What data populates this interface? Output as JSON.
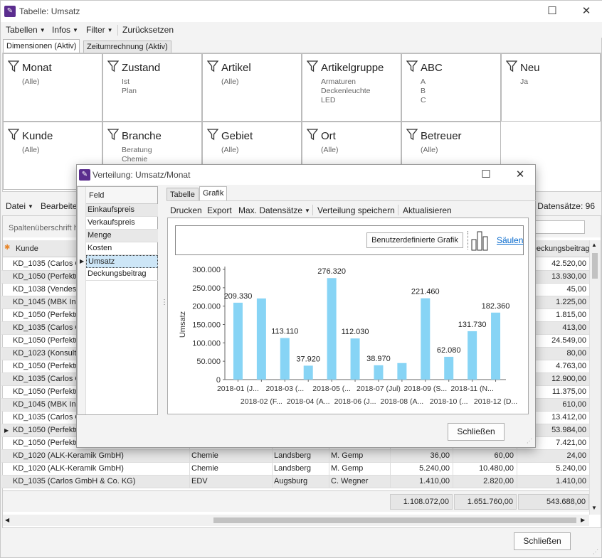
{
  "window": {
    "title": "Tabelle: Umsatz"
  },
  "menu": {
    "tabellen": "Tabellen",
    "infos": "Infos",
    "filter": "Filter",
    "reset": "Zurücksetzen"
  },
  "tabs": {
    "dims": "Dimensionen (Aktiv)",
    "time": "Zeitumrechnung (Aktiv)"
  },
  "dimensions": [
    {
      "name": "Monat",
      "values": [
        "(Alle)"
      ]
    },
    {
      "name": "Zustand",
      "values": [
        "Ist",
        "Plan"
      ]
    },
    {
      "name": "Artikel",
      "values": [
        "(Alle)"
      ]
    },
    {
      "name": "Artikelgruppe",
      "values": [
        "Armaturen",
        "Deckenleuchte",
        "LED"
      ]
    },
    {
      "name": "ABC",
      "values": [
        "A",
        "B",
        "C"
      ]
    },
    {
      "name": "Neu",
      "values": [
        "Ja"
      ]
    },
    {
      "name": "Kunde",
      "values": [
        "(Alle)"
      ]
    },
    {
      "name": "Branche",
      "values": [
        "Beratung",
        "Chemie"
      ]
    },
    {
      "name": "Gebiet",
      "values": [
        "(Alle)"
      ]
    },
    {
      "name": "Ort",
      "values": [
        "(Alle)"
      ]
    },
    {
      "name": "Betreuer",
      "values": [
        "(Alle)"
      ]
    }
  ],
  "toolbar": {
    "datei": "Datei",
    "bearbeiten": "Bearbeiten",
    "datensaetze": "Datensätze: 96"
  },
  "grid": {
    "hint": "Spaltenüberschrift hierher ziehen, um nach dieser Spalte zu gruppieren",
    "col_kunde": "Kunde",
    "col_deckungsbeitrag": "Deckungsbeitrag",
    "rows": [
      {
        "kunde": "KD_1035 (Carlos GmbH & Co. KG)",
        "branche": "",
        "gebiet": "",
        "betreuer": "",
        "ek": "",
        "vk": "",
        "db": "42.520,00"
      },
      {
        "kunde": "KD_1050 (Perfektum AG)",
        "branche": "",
        "gebiet": "",
        "betreuer": "",
        "ek": "",
        "vk": "",
        "db": "13.930,00"
      },
      {
        "kunde": "KD_1038 (Vendes GmbH)",
        "branche": "",
        "gebiet": "",
        "betreuer": "",
        "ek": "",
        "vk": "",
        "db": "45,00"
      },
      {
        "kunde": "KD_1045 (MBK Innenausbau)",
        "branche": "",
        "gebiet": "",
        "betreuer": "",
        "ek": "",
        "vk": "",
        "db": "1.225,00"
      },
      {
        "kunde": "KD_1050 (Perfektum AG)",
        "branche": "",
        "gebiet": "",
        "betreuer": "",
        "ek": "",
        "vk": "",
        "db": "1.815,00"
      },
      {
        "kunde": "KD_1035 (Carlos GmbH & Co. KG)",
        "branche": "",
        "gebiet": "",
        "betreuer": "",
        "ek": "",
        "vk": "",
        "db": "413,00"
      },
      {
        "kunde": "KD_1050 (Perfektum AG)",
        "branche": "",
        "gebiet": "",
        "betreuer": "",
        "ek": "",
        "vk": "",
        "db": "24.549,00"
      },
      {
        "kunde": "KD_1023 (Konsult GmbH)",
        "branche": "",
        "gebiet": "",
        "betreuer": "",
        "ek": "",
        "vk": "",
        "db": "80,00"
      },
      {
        "kunde": "KD_1050 (Perfektum AG)",
        "branche": "",
        "gebiet": "",
        "betreuer": "",
        "ek": "",
        "vk": "",
        "db": "4.763,00"
      },
      {
        "kunde": "KD_1035 (Carlos GmbH & Co. KG)",
        "branche": "",
        "gebiet": "",
        "betreuer": "",
        "ek": "",
        "vk": "",
        "db": "12.900,00"
      },
      {
        "kunde": "KD_1050 (Perfektum AG)",
        "branche": "",
        "gebiet": "",
        "betreuer": "",
        "ek": "",
        "vk": "",
        "db": "11.375,00"
      },
      {
        "kunde": "KD_1045 (MBK Innenausbau)",
        "branche": "",
        "gebiet": "",
        "betreuer": "",
        "ek": "",
        "vk": "",
        "db": "610,00"
      },
      {
        "kunde": "KD_1035 (Carlos GmbH & Co. KG)",
        "branche": "",
        "gebiet": "",
        "betreuer": "",
        "ek": "",
        "vk": "",
        "db": "13.412,00"
      },
      {
        "kunde": "KD_1050 (Perfektum AG)",
        "branche": "",
        "gebiet": "",
        "betreuer": "",
        "ek": "",
        "vk": "",
        "db": "53.984,00"
      },
      {
        "kunde": "KD_1050 (Perfektum AG)",
        "branche": "",
        "gebiet": "",
        "betreuer": "",
        "ek": "",
        "vk": "",
        "db": "7.421,00"
      },
      {
        "kunde": "KD_1020 (ALK-Keramik GmbH)",
        "branche": "Chemie",
        "gebiet": "Landsberg",
        "betreuer": "M. Gemp",
        "ek": "36,00",
        "vk": "60,00",
        "db": "24,00"
      },
      {
        "kunde": "KD_1020 (ALK-Keramik GmbH)",
        "branche": "Chemie",
        "gebiet": "Landsberg",
        "betreuer": "M. Gemp",
        "ek": "5.240,00",
        "vk": "10.480,00",
        "db": "5.240,00"
      },
      {
        "kunde": "KD_1035 (Carlos GmbH & Co. KG)",
        "branche": "EDV",
        "gebiet": "Augsburg",
        "betreuer": "C. Wegner",
        "ek": "1.410,00",
        "vk": "2.820,00",
        "db": "1.410,00"
      }
    ],
    "totals": {
      "ek": "1.108.072,00",
      "vk": "1.651.760,00",
      "db": "543.688,00"
    }
  },
  "close_button": "Schließen",
  "dialog": {
    "title": "Verteilung: Umsatz/Monat",
    "field_header": "Feld",
    "fields": [
      "Einkaufspreis",
      "Verkaufspreis",
      "Menge",
      "Kosten",
      "Umsatz",
      "Deckungsbeitrag"
    ],
    "tabs": {
      "tabelle": "Tabelle",
      "grafik": "Grafik"
    },
    "toolbar": {
      "drucken": "Drucken",
      "export": "Export",
      "max": "Max. Datensätze",
      "speichern": "Verteilung speichern",
      "aktualisieren": "Aktualisieren"
    },
    "custom_chart": "Benutzerdefinierte Grafik",
    "chart_kind": "Säulen",
    "close": "Schließen"
  },
  "colors": {
    "bar": "#87d4f5",
    "accent": "#5b2d8e",
    "link": "#0066cc"
  },
  "chart_data": {
    "type": "bar",
    "categories": [
      "2018-01 (J...",
      "2018-02 (F...",
      "2018-03 (...",
      "2018-04 (A...",
      "2018-05 (...",
      "2018-06 (J...",
      "2018-07 (Jul)",
      "2018-08 (A...",
      "2018-09 (S...",
      "2018-10 (...",
      "2018-11 (N...",
      "2018-12 (D..."
    ],
    "values": [
      209330,
      221000,
      113110,
      37920,
      276320,
      112030,
      38970,
      45000,
      221460,
      62080,
      131730,
      182360
    ],
    "data_labels": [
      "209.330",
      "",
      "113.110",
      "37.920",
      "276.320",
      "112.030",
      "38.970",
      "",
      "221.460",
      "62.080",
      "131.730",
      "182.360"
    ],
    "ylabel": "Umsatz",
    "ylim": [
      0,
      300000
    ],
    "yticks": [
      "0",
      "50.000",
      "100.000",
      "150.000",
      "200.000",
      "250.000",
      "300.000"
    ],
    "grid": false
  }
}
